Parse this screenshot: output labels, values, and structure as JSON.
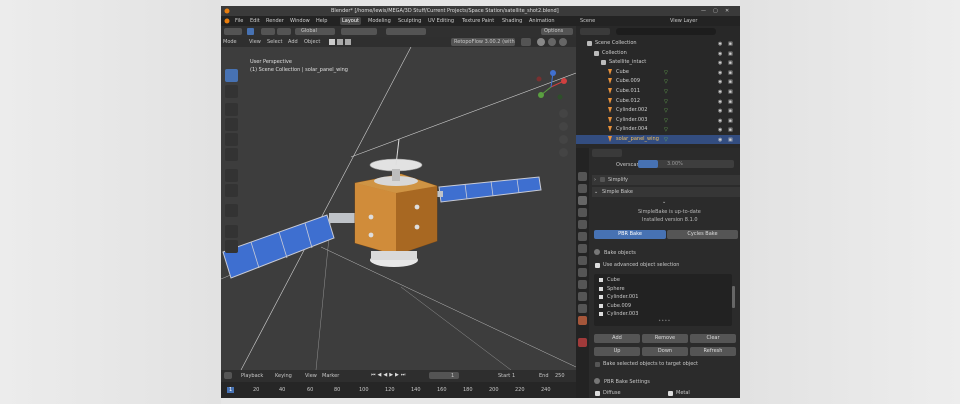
{
  "window_title": "Blender* [/home/lewis/MEGA/3D Stuff/Current Projects/Space Station/satellite_shot2.blend]",
  "menu": [
    "File",
    "Edit",
    "Render",
    "Window",
    "Help"
  ],
  "workspaces": [
    "Layout",
    "Modeling",
    "Sculpting",
    "UV Editing",
    "Texture Paint",
    "Shading",
    "Animation"
  ],
  "scene_label": "Scene",
  "view_layer_label": "View Layer",
  "header": {
    "transform": "Global",
    "options": "Options",
    "retopoflow": "RetopoFlow 3.00.2 (with"
  },
  "viewport_menu": [
    "Mode",
    "View",
    "Select",
    "Add",
    "Object"
  ],
  "viewport": {
    "perspective": "User Perspective",
    "collection": "(1) Scene Collection | solar_panel_wing"
  },
  "outliner": {
    "items": [
      {
        "label": "Scene Collection",
        "indent": 1,
        "type": "collection"
      },
      {
        "label": "Collection",
        "indent": 2,
        "type": "collection"
      },
      {
        "label": "Satellite_intact",
        "indent": 3,
        "type": "object"
      },
      {
        "label": "Cube",
        "indent": 4,
        "type": "mesh"
      },
      {
        "label": "Cube.009",
        "indent": 4,
        "type": "mesh"
      },
      {
        "label": "Cube.011",
        "indent": 4,
        "type": "mesh"
      },
      {
        "label": "Cube.012",
        "indent": 4,
        "type": "mesh"
      },
      {
        "label": "Cylinder.002",
        "indent": 4,
        "type": "mesh"
      },
      {
        "label": "Cylinder.003",
        "indent": 4,
        "type": "mesh"
      },
      {
        "label": "Cylinder.004",
        "indent": 4,
        "type": "mesh"
      },
      {
        "label": "solar_panel_wing",
        "indent": 4,
        "type": "mesh",
        "selected": true
      }
    ]
  },
  "properties": {
    "overscan_label": "Overscan",
    "overscan_value": "3.00%",
    "simplify": "Simplify",
    "simple_bake": "Simple Bake",
    "update_line1": "SimpleBake is up-to-date",
    "update_line2": "Installed version 8.1.0",
    "pbr_bake": "PBR Bake",
    "cycles_bake": "Cycles Bake",
    "bake_objects": "Bake objects",
    "use_advanced": "Use advanced object selection",
    "bake_list": [
      "Cube",
      "Sphere",
      "Cylinder.001",
      "Cube.009",
      "Cylinder.003"
    ],
    "add": "Add",
    "remove": "Remove",
    "clear": "Clear",
    "up": "Up",
    "down": "Down",
    "refresh": "Refresh",
    "bake_selected": "Bake selected objects to target object",
    "pbr_settings": "PBR Bake Settings",
    "diffuse": "Diffuse",
    "metal": "Metal"
  },
  "timeline": {
    "playback": "Playback",
    "keying": "Keying",
    "view": "View",
    "marker": "Marker",
    "current_frame": "1",
    "start_label": "Start",
    "start": "1",
    "end_label": "End",
    "end": "250",
    "ruler": [
      "1",
      "20",
      "40",
      "60",
      "80",
      "100",
      "120",
      "140",
      "160",
      "180",
      "200",
      "220",
      "240"
    ]
  }
}
